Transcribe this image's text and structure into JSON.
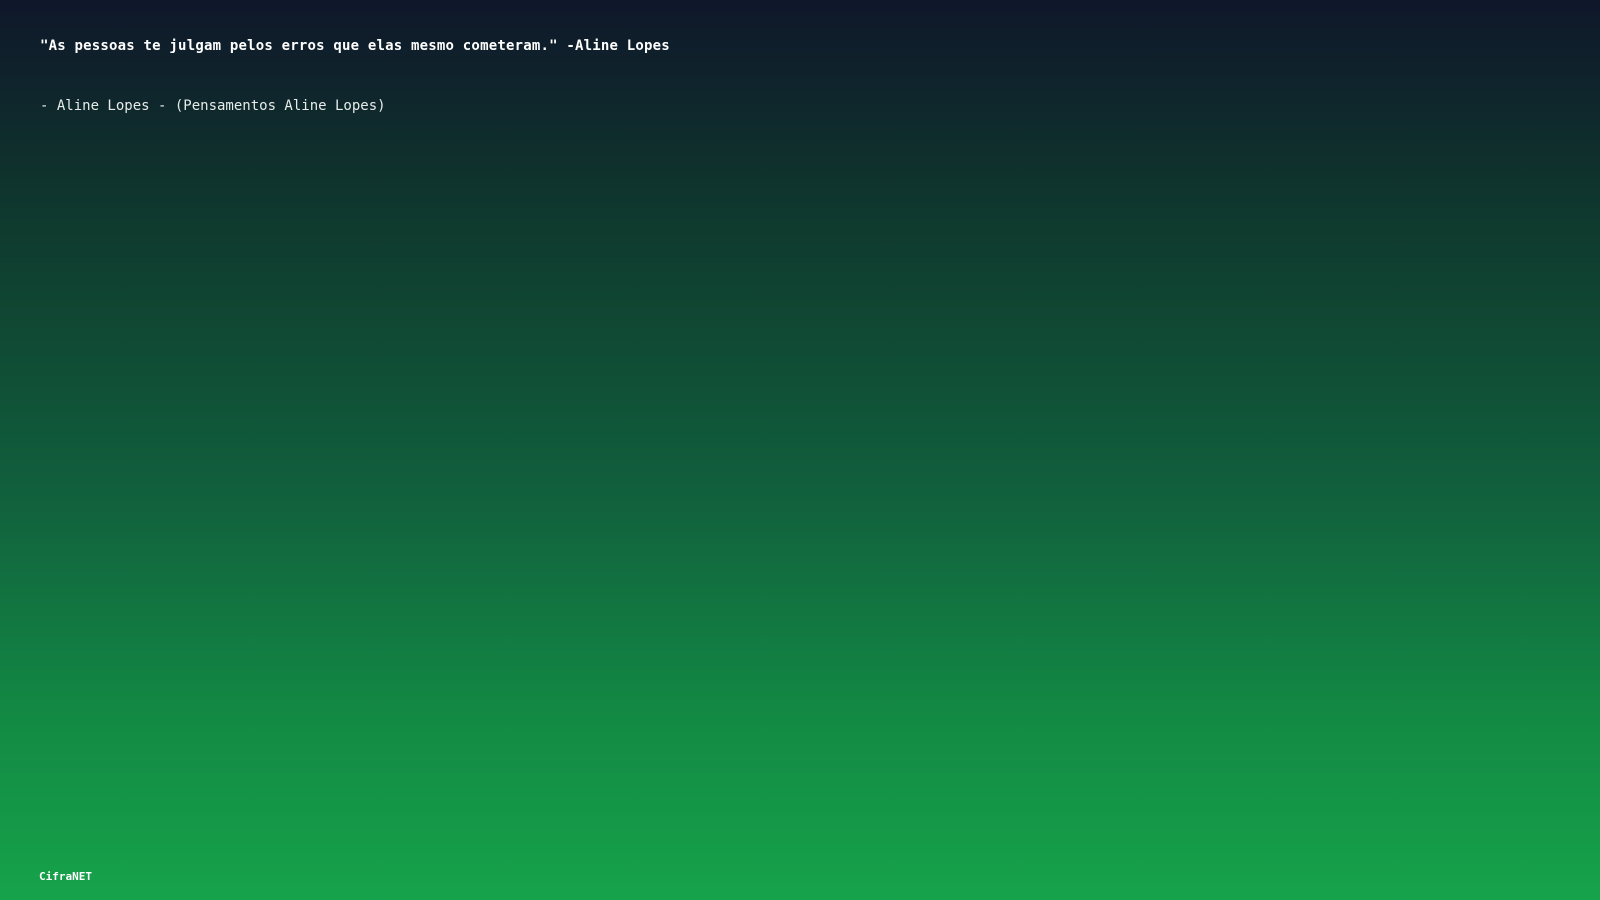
{
  "content": {
    "quote": "\"As pessoas te julgam pelos erros que elas mesmo cometeram.\" -Aline Lopes",
    "attribution": "- Aline Lopes - (Pensamentos Aline Lopes)"
  },
  "footer": {
    "brand": "CifraNET"
  },
  "colors": {
    "gradient_top": "#0f172a",
    "gradient_bottom": "#16a34a",
    "text": "#ffffff"
  }
}
